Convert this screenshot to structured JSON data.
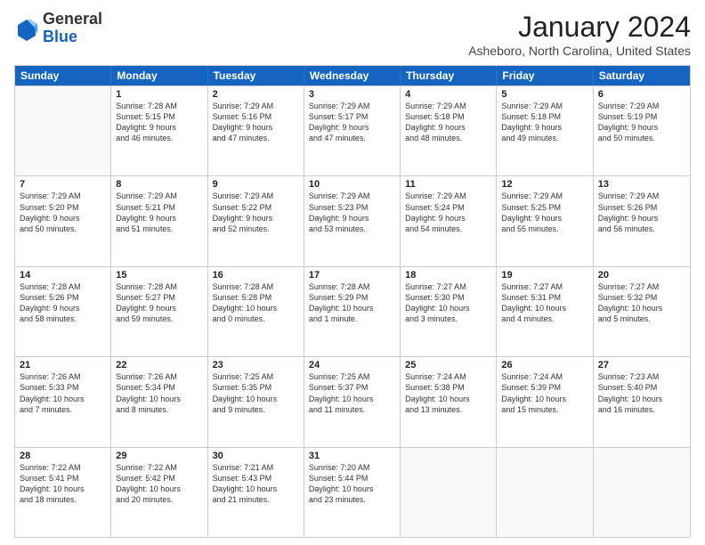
{
  "logo": {
    "general": "General",
    "blue": "Blue"
  },
  "title": "January 2024",
  "location": "Asheboro, North Carolina, United States",
  "header_days": [
    "Sunday",
    "Monday",
    "Tuesday",
    "Wednesday",
    "Thursday",
    "Friday",
    "Saturday"
  ],
  "rows": [
    [
      {
        "day": "",
        "lines": []
      },
      {
        "day": "1",
        "lines": [
          "Sunrise: 7:28 AM",
          "Sunset: 5:15 PM",
          "Daylight: 9 hours",
          "and 46 minutes."
        ]
      },
      {
        "day": "2",
        "lines": [
          "Sunrise: 7:29 AM",
          "Sunset: 5:16 PM",
          "Daylight: 9 hours",
          "and 47 minutes."
        ]
      },
      {
        "day": "3",
        "lines": [
          "Sunrise: 7:29 AM",
          "Sunset: 5:17 PM",
          "Daylight: 9 hours",
          "and 47 minutes."
        ]
      },
      {
        "day": "4",
        "lines": [
          "Sunrise: 7:29 AM",
          "Sunset: 5:18 PM",
          "Daylight: 9 hours",
          "and 48 minutes."
        ]
      },
      {
        "day": "5",
        "lines": [
          "Sunrise: 7:29 AM",
          "Sunset: 5:18 PM",
          "Daylight: 9 hours",
          "and 49 minutes."
        ]
      },
      {
        "day": "6",
        "lines": [
          "Sunrise: 7:29 AM",
          "Sunset: 5:19 PM",
          "Daylight: 9 hours",
          "and 50 minutes."
        ]
      }
    ],
    [
      {
        "day": "7",
        "lines": [
          "Sunrise: 7:29 AM",
          "Sunset: 5:20 PM",
          "Daylight: 9 hours",
          "and 50 minutes."
        ]
      },
      {
        "day": "8",
        "lines": [
          "Sunrise: 7:29 AM",
          "Sunset: 5:21 PM",
          "Daylight: 9 hours",
          "and 51 minutes."
        ]
      },
      {
        "day": "9",
        "lines": [
          "Sunrise: 7:29 AM",
          "Sunset: 5:22 PM",
          "Daylight: 9 hours",
          "and 52 minutes."
        ]
      },
      {
        "day": "10",
        "lines": [
          "Sunrise: 7:29 AM",
          "Sunset: 5:23 PM",
          "Daylight: 9 hours",
          "and 53 minutes."
        ]
      },
      {
        "day": "11",
        "lines": [
          "Sunrise: 7:29 AM",
          "Sunset: 5:24 PM",
          "Daylight: 9 hours",
          "and 54 minutes."
        ]
      },
      {
        "day": "12",
        "lines": [
          "Sunrise: 7:29 AM",
          "Sunset: 5:25 PM",
          "Daylight: 9 hours",
          "and 55 minutes."
        ]
      },
      {
        "day": "13",
        "lines": [
          "Sunrise: 7:29 AM",
          "Sunset: 5:26 PM",
          "Daylight: 9 hours",
          "and 56 minutes."
        ]
      }
    ],
    [
      {
        "day": "14",
        "lines": [
          "Sunrise: 7:28 AM",
          "Sunset: 5:26 PM",
          "Daylight: 9 hours",
          "and 58 minutes."
        ]
      },
      {
        "day": "15",
        "lines": [
          "Sunrise: 7:28 AM",
          "Sunset: 5:27 PM",
          "Daylight: 9 hours",
          "and 59 minutes."
        ]
      },
      {
        "day": "16",
        "lines": [
          "Sunrise: 7:28 AM",
          "Sunset: 5:28 PM",
          "Daylight: 10 hours",
          "and 0 minutes."
        ]
      },
      {
        "day": "17",
        "lines": [
          "Sunrise: 7:28 AM",
          "Sunset: 5:29 PM",
          "Daylight: 10 hours",
          "and 1 minute."
        ]
      },
      {
        "day": "18",
        "lines": [
          "Sunrise: 7:27 AM",
          "Sunset: 5:30 PM",
          "Daylight: 10 hours",
          "and 3 minutes."
        ]
      },
      {
        "day": "19",
        "lines": [
          "Sunrise: 7:27 AM",
          "Sunset: 5:31 PM",
          "Daylight: 10 hours",
          "and 4 minutes."
        ]
      },
      {
        "day": "20",
        "lines": [
          "Sunrise: 7:27 AM",
          "Sunset: 5:32 PM",
          "Daylight: 10 hours",
          "and 5 minutes."
        ]
      }
    ],
    [
      {
        "day": "21",
        "lines": [
          "Sunrise: 7:26 AM",
          "Sunset: 5:33 PM",
          "Daylight: 10 hours",
          "and 7 minutes."
        ]
      },
      {
        "day": "22",
        "lines": [
          "Sunrise: 7:26 AM",
          "Sunset: 5:34 PM",
          "Daylight: 10 hours",
          "and 8 minutes."
        ]
      },
      {
        "day": "23",
        "lines": [
          "Sunrise: 7:25 AM",
          "Sunset: 5:35 PM",
          "Daylight: 10 hours",
          "and 9 minutes."
        ]
      },
      {
        "day": "24",
        "lines": [
          "Sunrise: 7:25 AM",
          "Sunset: 5:37 PM",
          "Daylight: 10 hours",
          "and 11 minutes."
        ]
      },
      {
        "day": "25",
        "lines": [
          "Sunrise: 7:24 AM",
          "Sunset: 5:38 PM",
          "Daylight: 10 hours",
          "and 13 minutes."
        ]
      },
      {
        "day": "26",
        "lines": [
          "Sunrise: 7:24 AM",
          "Sunset: 5:39 PM",
          "Daylight: 10 hours",
          "and 15 minutes."
        ]
      },
      {
        "day": "27",
        "lines": [
          "Sunrise: 7:23 AM",
          "Sunset: 5:40 PM",
          "Daylight: 10 hours",
          "and 16 minutes."
        ]
      }
    ],
    [
      {
        "day": "28",
        "lines": [
          "Sunrise: 7:22 AM",
          "Sunset: 5:41 PM",
          "Daylight: 10 hours",
          "and 18 minutes."
        ]
      },
      {
        "day": "29",
        "lines": [
          "Sunrise: 7:22 AM",
          "Sunset: 5:42 PM",
          "Daylight: 10 hours",
          "and 20 minutes."
        ]
      },
      {
        "day": "30",
        "lines": [
          "Sunrise: 7:21 AM",
          "Sunset: 5:43 PM",
          "Daylight: 10 hours",
          "and 21 minutes."
        ]
      },
      {
        "day": "31",
        "lines": [
          "Sunrise: 7:20 AM",
          "Sunset: 5:44 PM",
          "Daylight: 10 hours",
          "and 23 minutes."
        ]
      },
      {
        "day": "",
        "lines": []
      },
      {
        "day": "",
        "lines": []
      },
      {
        "day": "",
        "lines": []
      }
    ]
  ]
}
